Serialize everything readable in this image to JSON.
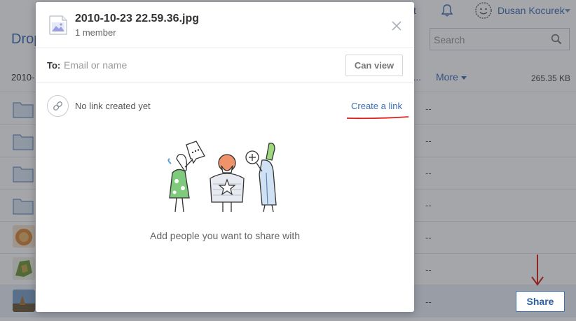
{
  "background": {
    "topbar_partial_link": "t",
    "user_name": "Dusan Kocurek",
    "title_partial": "Drop",
    "search_placeholder": "Search",
    "breadcrumb_partial": "2010-",
    "ellipsis": "...",
    "more_label": "More",
    "size_label": "265.35 KB",
    "row_dash": "--",
    "share_label": "Share"
  },
  "modal": {
    "file_name": "2010-10-23 22.59.36.jpg",
    "members": "1 member",
    "to_label": "To:",
    "to_placeholder": "Email or name",
    "permission_label": "Can view",
    "link_status": "No link created yet",
    "create_link_label": "Create a link",
    "empty_message": "Add people you want to share with"
  },
  "colors": {
    "accent": "#3d6fb5",
    "annotation": "#e0201b"
  }
}
